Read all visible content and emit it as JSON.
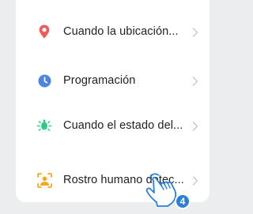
{
  "conditions": [
    {
      "label": "Cuando la ubicación...",
      "icon": "location-pin-icon",
      "color": "#ef5b5b"
    },
    {
      "label": "Programación",
      "icon": "clock-icon",
      "color": "#4a86e0"
    },
    {
      "label": "Cuando el estado del...",
      "icon": "device-status-icon",
      "color": "#2ec98a"
    },
    {
      "label": "Rostro humano detec...",
      "icon": "face-detection-icon",
      "color": "#f4a81d"
    }
  ],
  "tap_indicator": {
    "step": "4",
    "color": "#2a7fd9"
  }
}
